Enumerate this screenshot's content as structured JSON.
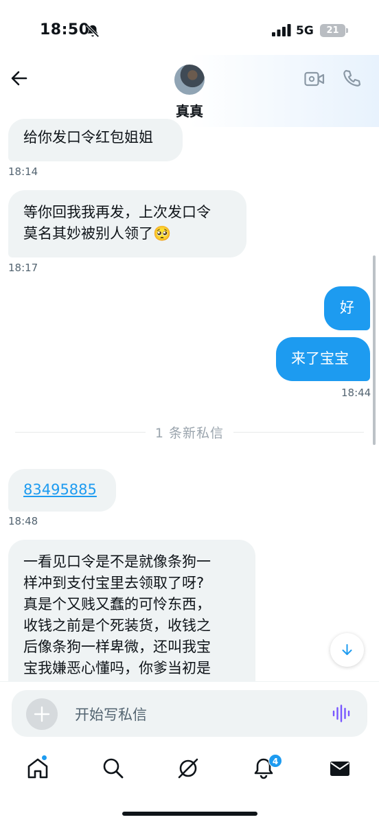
{
  "status_bar": {
    "time": "18:50",
    "network": "5G",
    "battery": "21"
  },
  "header": {
    "contact_name": "真真"
  },
  "messages": [
    {
      "direction": "incoming",
      "lines": [
        "给你发口令红包姐姐"
      ],
      "time": "18:14"
    },
    {
      "direction": "incoming",
      "lines": [
        "等你回我我再发，上次发口令",
        "莫名其妙被别人领了🥺"
      ],
      "time": "18:17"
    },
    {
      "direction": "outgoing",
      "lines": [
        "好"
      ],
      "time": ""
    },
    {
      "direction": "outgoing",
      "lines": [
        "来了宝宝"
      ],
      "time": "18:44"
    },
    {
      "direction": "incoming",
      "lines": [
        "83495885"
      ],
      "time": "18:48"
    },
    {
      "direction": "incoming",
      "lines": [
        "一看见口令是不是就像条狗一",
        "样冲到支付宝里去领取了呀?",
        "真是个又贱又蠢的可怜东西，",
        "收钱之前是个死装货，收钱之",
        "后像条狗一样卑微，还叫我宝",
        "宝我嫌恶心懂吗，你爹当初是"
      ],
      "time": ""
    }
  ],
  "divider": "1 条新私信",
  "composer": {
    "placeholder": "开始写私信"
  },
  "tabbar": {
    "notifications_badge": "4"
  },
  "colors": {
    "accent": "#1d9bf0",
    "incoming_bubble": "#eff3f4",
    "text": "#0f1419",
    "secondary_text": "#536471",
    "voice_icon": "#7856ff"
  },
  "icons": [
    "bell-slash-icon",
    "signal-icon",
    "battery-icon",
    "back-arrow-icon",
    "video-call-icon",
    "phone-icon",
    "scroll-down-icon",
    "plus-icon",
    "voice-icon",
    "home-icon",
    "search-icon",
    "grok-icon",
    "bell-icon",
    "mail-icon"
  ]
}
